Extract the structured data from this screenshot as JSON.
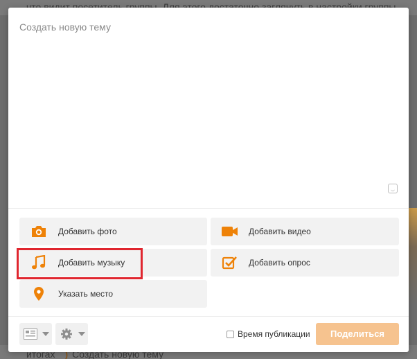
{
  "background": {
    "top_text": "что видит посетитель группы. Для этого достаточно заглянуть в настройки группы",
    "bottom_text_prefix": "итогах",
    "bottom_text": "Создать новую тему"
  },
  "composer": {
    "placeholder": "Создать новую тему",
    "smiley_icon": "smiley-icon"
  },
  "attachments": {
    "photo": {
      "label": "Добавить фото",
      "icon": "camera-icon"
    },
    "video": {
      "label": "Добавить видео",
      "icon": "video-camera-icon"
    },
    "music": {
      "label": "Добавить музыку",
      "icon": "music-note-icon"
    },
    "poll": {
      "label": "Добавить опрос",
      "icon": "checkbox-check-icon"
    },
    "place": {
      "label": "Указать место",
      "icon": "location-pin-icon"
    }
  },
  "footer": {
    "publication_time_label": "Время публикации",
    "publication_time_checked": false,
    "share_label": "Поделиться"
  },
  "colors": {
    "accent_orange": "#ee8208",
    "share_button_disabled": "#f6c38f",
    "highlight_red": "#e0262f"
  }
}
